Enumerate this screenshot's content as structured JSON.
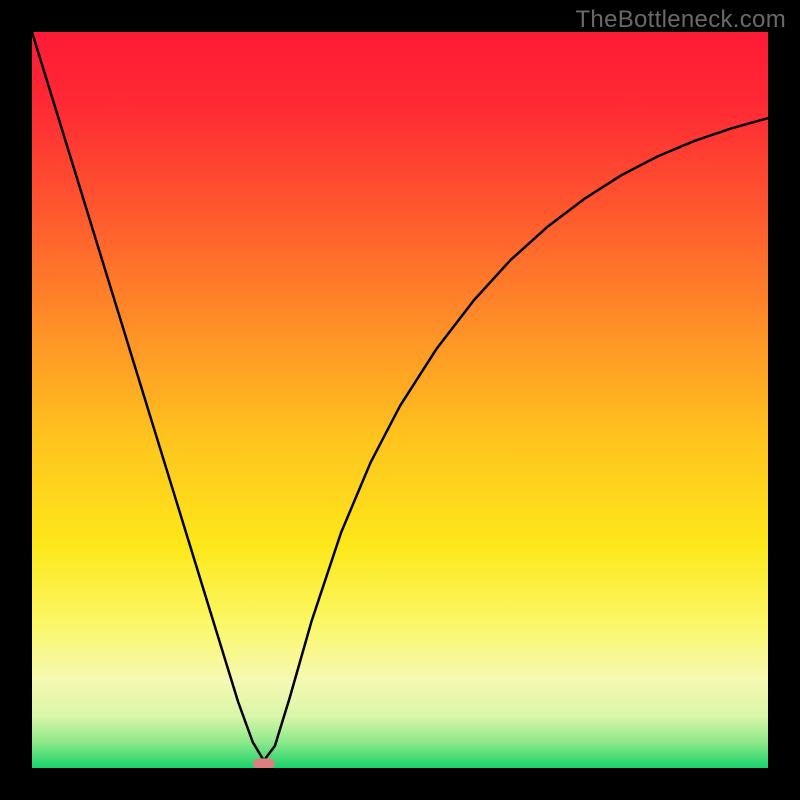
{
  "header": {
    "attribution": "TheBottleneck.com"
  },
  "chart_data": {
    "type": "line",
    "title": "",
    "xlabel": "",
    "ylabel": "",
    "xlim": [
      0,
      1
    ],
    "ylim": [
      0,
      1
    ],
    "grid": false,
    "gradient_stops": [
      {
        "offset": 0.0,
        "color": "#ff1a36"
      },
      {
        "offset": 0.1,
        "color": "#ff2a34"
      },
      {
        "offset": 0.25,
        "color": "#ff5a2e"
      },
      {
        "offset": 0.4,
        "color": "#ff8f28"
      },
      {
        "offset": 0.55,
        "color": "#ffc31e"
      },
      {
        "offset": 0.7,
        "color": "#fde81a"
      },
      {
        "offset": 0.8,
        "color": "#fbf764"
      },
      {
        "offset": 0.88,
        "color": "#f6f9b2"
      },
      {
        "offset": 0.93,
        "color": "#d8f6a8"
      },
      {
        "offset": 0.965,
        "color": "#8ee88a"
      },
      {
        "offset": 1.0,
        "color": "#18d36a"
      }
    ],
    "series": [
      {
        "name": "bottleneck-curve",
        "color": "#000000",
        "stroke_width": 2.5,
        "x": [
          0.0,
          0.02,
          0.04,
          0.06,
          0.08,
          0.1,
          0.12,
          0.14,
          0.16,
          0.18,
          0.2,
          0.22,
          0.24,
          0.26,
          0.28,
          0.3,
          0.315,
          0.33,
          0.35,
          0.38,
          0.42,
          0.46,
          0.5,
          0.55,
          0.6,
          0.65,
          0.7,
          0.75,
          0.8,
          0.85,
          0.9,
          0.95,
          1.0
        ],
        "y": [
          1.0,
          0.935,
          0.87,
          0.805,
          0.74,
          0.675,
          0.61,
          0.545,
          0.48,
          0.415,
          0.35,
          0.285,
          0.22,
          0.155,
          0.09,
          0.035,
          0.01,
          0.03,
          0.095,
          0.2,
          0.32,
          0.415,
          0.492,
          0.57,
          0.635,
          0.69,
          0.735,
          0.773,
          0.805,
          0.831,
          0.852,
          0.869,
          0.883
        ]
      }
    ],
    "markers": [
      {
        "name": "optimal-point-marker",
        "shape": "rounded-rect",
        "x": 0.315,
        "y": 0.006,
        "width_frac": 0.03,
        "height_frac": 0.014,
        "fill": "#d98080",
        "stroke": "#d98080"
      }
    ]
  }
}
